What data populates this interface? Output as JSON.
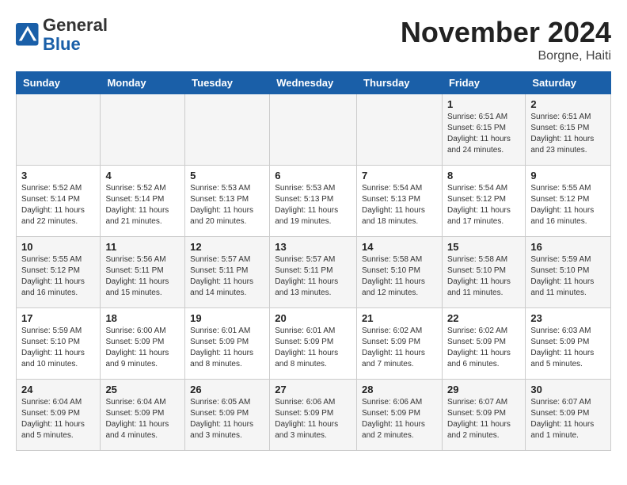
{
  "header": {
    "logo_general": "General",
    "logo_blue": "Blue",
    "month_title": "November 2024",
    "location": "Borgne, Haiti"
  },
  "weekdays": [
    "Sunday",
    "Monday",
    "Tuesday",
    "Wednesday",
    "Thursday",
    "Friday",
    "Saturday"
  ],
  "weeks": [
    [
      {
        "day": "",
        "info": ""
      },
      {
        "day": "",
        "info": ""
      },
      {
        "day": "",
        "info": ""
      },
      {
        "day": "",
        "info": ""
      },
      {
        "day": "",
        "info": ""
      },
      {
        "day": "1",
        "info": "Sunrise: 6:51 AM\nSunset: 6:15 PM\nDaylight: 11 hours\nand 24 minutes."
      },
      {
        "day": "2",
        "info": "Sunrise: 6:51 AM\nSunset: 6:15 PM\nDaylight: 11 hours\nand 23 minutes."
      }
    ],
    [
      {
        "day": "3",
        "info": "Sunrise: 5:52 AM\nSunset: 5:14 PM\nDaylight: 11 hours\nand 22 minutes."
      },
      {
        "day": "4",
        "info": "Sunrise: 5:52 AM\nSunset: 5:14 PM\nDaylight: 11 hours\nand 21 minutes."
      },
      {
        "day": "5",
        "info": "Sunrise: 5:53 AM\nSunset: 5:13 PM\nDaylight: 11 hours\nand 20 minutes."
      },
      {
        "day": "6",
        "info": "Sunrise: 5:53 AM\nSunset: 5:13 PM\nDaylight: 11 hours\nand 19 minutes."
      },
      {
        "day": "7",
        "info": "Sunrise: 5:54 AM\nSunset: 5:13 PM\nDaylight: 11 hours\nand 18 minutes."
      },
      {
        "day": "8",
        "info": "Sunrise: 5:54 AM\nSunset: 5:12 PM\nDaylight: 11 hours\nand 17 minutes."
      },
      {
        "day": "9",
        "info": "Sunrise: 5:55 AM\nSunset: 5:12 PM\nDaylight: 11 hours\nand 16 minutes."
      }
    ],
    [
      {
        "day": "10",
        "info": "Sunrise: 5:55 AM\nSunset: 5:12 PM\nDaylight: 11 hours\nand 16 minutes."
      },
      {
        "day": "11",
        "info": "Sunrise: 5:56 AM\nSunset: 5:11 PM\nDaylight: 11 hours\nand 15 minutes."
      },
      {
        "day": "12",
        "info": "Sunrise: 5:57 AM\nSunset: 5:11 PM\nDaylight: 11 hours\nand 14 minutes."
      },
      {
        "day": "13",
        "info": "Sunrise: 5:57 AM\nSunset: 5:11 PM\nDaylight: 11 hours\nand 13 minutes."
      },
      {
        "day": "14",
        "info": "Sunrise: 5:58 AM\nSunset: 5:10 PM\nDaylight: 11 hours\nand 12 minutes."
      },
      {
        "day": "15",
        "info": "Sunrise: 5:58 AM\nSunset: 5:10 PM\nDaylight: 11 hours\nand 11 minutes."
      },
      {
        "day": "16",
        "info": "Sunrise: 5:59 AM\nSunset: 5:10 PM\nDaylight: 11 hours\nand 11 minutes."
      }
    ],
    [
      {
        "day": "17",
        "info": "Sunrise: 5:59 AM\nSunset: 5:10 PM\nDaylight: 11 hours\nand 10 minutes."
      },
      {
        "day": "18",
        "info": "Sunrise: 6:00 AM\nSunset: 5:09 PM\nDaylight: 11 hours\nand 9 minutes."
      },
      {
        "day": "19",
        "info": "Sunrise: 6:01 AM\nSunset: 5:09 PM\nDaylight: 11 hours\nand 8 minutes."
      },
      {
        "day": "20",
        "info": "Sunrise: 6:01 AM\nSunset: 5:09 PM\nDaylight: 11 hours\nand 8 minutes."
      },
      {
        "day": "21",
        "info": "Sunrise: 6:02 AM\nSunset: 5:09 PM\nDaylight: 11 hours\nand 7 minutes."
      },
      {
        "day": "22",
        "info": "Sunrise: 6:02 AM\nSunset: 5:09 PM\nDaylight: 11 hours\nand 6 minutes."
      },
      {
        "day": "23",
        "info": "Sunrise: 6:03 AM\nSunset: 5:09 PM\nDaylight: 11 hours\nand 5 minutes."
      }
    ],
    [
      {
        "day": "24",
        "info": "Sunrise: 6:04 AM\nSunset: 5:09 PM\nDaylight: 11 hours\nand 5 minutes."
      },
      {
        "day": "25",
        "info": "Sunrise: 6:04 AM\nSunset: 5:09 PM\nDaylight: 11 hours\nand 4 minutes."
      },
      {
        "day": "26",
        "info": "Sunrise: 6:05 AM\nSunset: 5:09 PM\nDaylight: 11 hours\nand 3 minutes."
      },
      {
        "day": "27",
        "info": "Sunrise: 6:06 AM\nSunset: 5:09 PM\nDaylight: 11 hours\nand 3 minutes."
      },
      {
        "day": "28",
        "info": "Sunrise: 6:06 AM\nSunset: 5:09 PM\nDaylight: 11 hours\nand 2 minutes."
      },
      {
        "day": "29",
        "info": "Sunrise: 6:07 AM\nSunset: 5:09 PM\nDaylight: 11 hours\nand 2 minutes."
      },
      {
        "day": "30",
        "info": "Sunrise: 6:07 AM\nSunset: 5:09 PM\nDaylight: 11 hours\nand 1 minute."
      }
    ]
  ]
}
